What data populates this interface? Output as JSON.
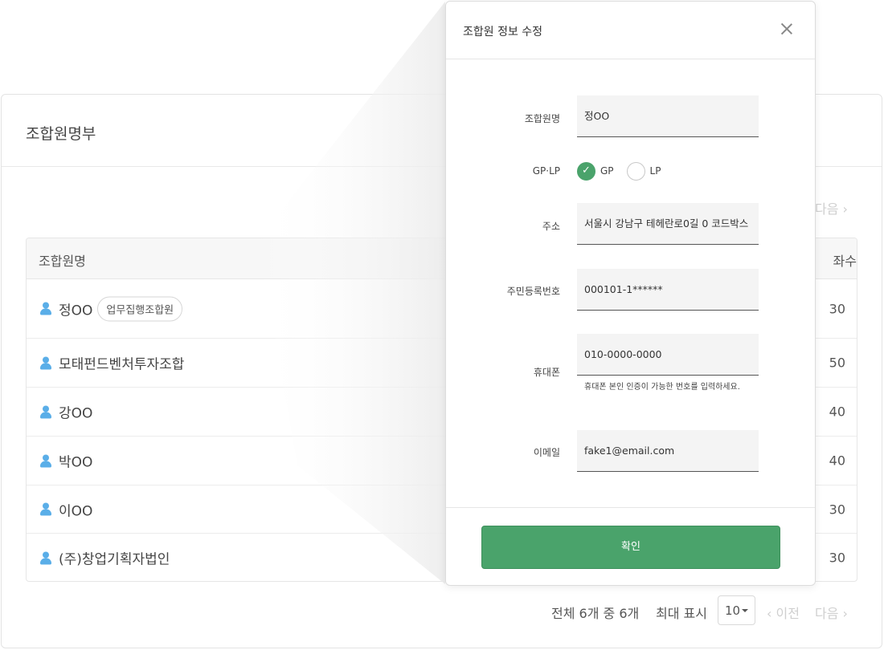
{
  "card": {
    "title": "조합원명부",
    "top_next": "다음 ›"
  },
  "table": {
    "header": {
      "name": "조합원명",
      "count": "좌수"
    },
    "rows": [
      {
        "name": "정OO",
        "badge": "업무집행조합원",
        "count": "30"
      },
      {
        "name": "모태펀드벤처투자조합",
        "badge": "",
        "count": "50"
      },
      {
        "name": "강OO",
        "badge": "",
        "count": "40"
      },
      {
        "name": "박OO",
        "badge": "",
        "count": "40"
      },
      {
        "name": "이OO",
        "badge": "",
        "count": "30"
      },
      {
        "name": "(주)창업기획자법인",
        "badge": "",
        "count": "30"
      }
    ]
  },
  "footer": {
    "total": "전체 6개 중 6개",
    "max_label": "최대 표시",
    "page_size": "10",
    "prev": "‹ 이전",
    "next": "다음 ›"
  },
  "modal": {
    "title": "조합원 정보 수정",
    "fields": {
      "name_label": "조합원명",
      "name_value": "정OO",
      "type_label": "GP·LP",
      "type_options": [
        "GP",
        "LP"
      ],
      "type_selected": "GP",
      "address_label": "주소",
      "address_value": "서울시 강남구 테헤란로0길 0 코드박스",
      "rrn_label": "주민등록번호",
      "rrn_value": "000101-1******",
      "phone_label": "휴대폰",
      "phone_value": "010-0000-0000",
      "phone_hint": "휴대폰 본인 인증이 가능한 번호를 입력하세요.",
      "email_label": "이메일",
      "email_value": "fake1@email.com"
    },
    "confirm_label": "확인"
  },
  "colors": {
    "accent_green": "#4aa36b",
    "person_icon_blue": "#5aaee8"
  }
}
